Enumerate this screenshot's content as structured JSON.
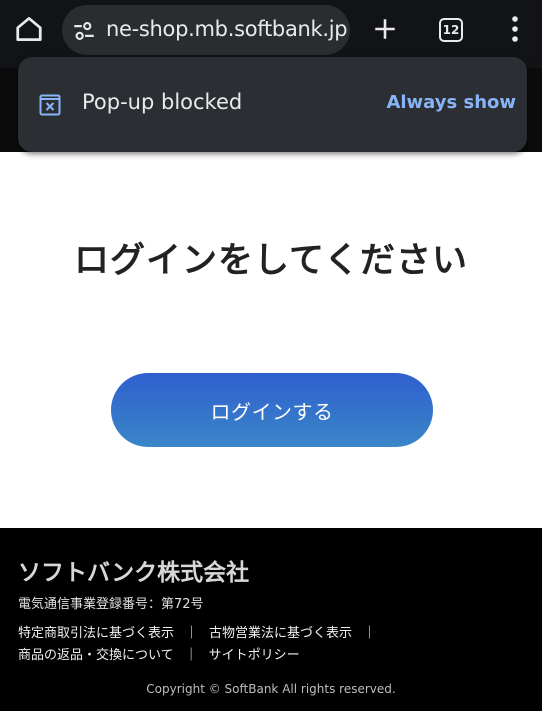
{
  "browser": {
    "url": "ne-shop.mb.softbank.jp",
    "tab_count": "12",
    "icons": {
      "home": "home-icon",
      "site_settings": "tune-icon",
      "new_tab": "plus-icon",
      "tabs": "tab-switcher-icon",
      "menu": "more-vert-icon"
    }
  },
  "popup_notice": {
    "message": "Pop-up blocked",
    "action": "Always show",
    "icon": "popup-blocked-icon"
  },
  "main": {
    "heading": "ログインをしてください",
    "login_button": "ログインする"
  },
  "footer": {
    "company": "ソフトバンク株式会社",
    "registration": "電気通信事業登録番号：第72号",
    "links_row1": [
      "特定商取引法に基づく表示",
      "古物営業法に基づく表示"
    ],
    "links_row2": [
      "商品の返品・交換について",
      "サイトポリシー"
    ],
    "separator": "｜",
    "copyright": "Copyright © SoftBank All rights reserved."
  },
  "colors": {
    "toolbar_bg": "#121317",
    "snackbar_bg": "#2b2f33",
    "action_blue": "#8ab4f8",
    "button_gradient_top": "#2f5fcf",
    "button_gradient_bottom": "#3a86c7",
    "footer_bg": "#000000"
  }
}
